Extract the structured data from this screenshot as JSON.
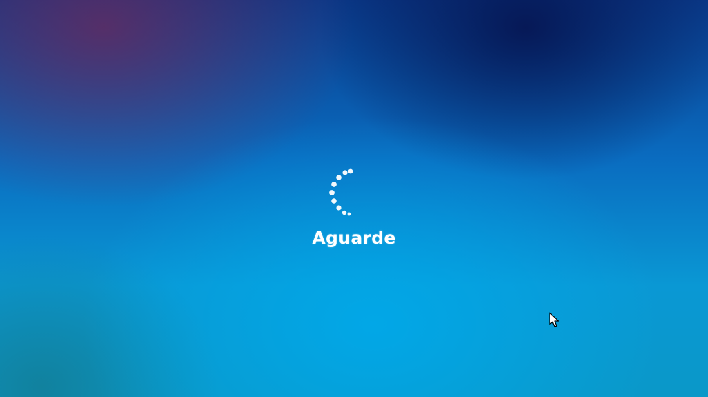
{
  "loading_screen": {
    "status_text": "Aguarde",
    "spinner_icon": "loading-dots-spinner-icon",
    "cursor_icon": "mouse-pointer-icon"
  },
  "colors": {
    "background_top": "#0a3a8a",
    "background_center": "#00a8e8",
    "text": "#ffffff",
    "spinner_dots": "#ffffff"
  }
}
